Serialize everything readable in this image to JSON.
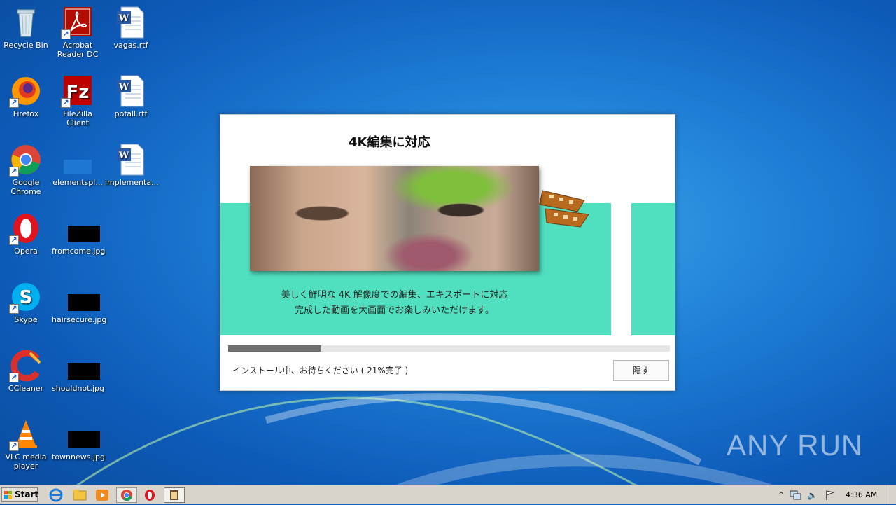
{
  "desktop": {
    "icons": [
      {
        "label": "Recycle Bin",
        "icon": "recycle-bin-icon"
      },
      {
        "label": "Acrobat Reader DC",
        "icon": "acrobat-icon"
      },
      {
        "label": "vagas.rtf",
        "icon": "word-doc-icon"
      },
      {
        "label": "Firefox",
        "icon": "firefox-icon"
      },
      {
        "label": "FileZilla Client",
        "icon": "filezilla-icon"
      },
      {
        "label": "pofall.rtf",
        "icon": "word-doc-icon"
      },
      {
        "label": "Google Chrome",
        "icon": "chrome-icon"
      },
      {
        "label": "elementspl...",
        "icon": "blank-file-icon"
      },
      {
        "label": "implementa...",
        "icon": "word-doc-icon"
      },
      {
        "label": "Opera",
        "icon": "opera-icon"
      },
      {
        "label": "fromcome.jpg",
        "icon": "image-thumb-icon"
      },
      {
        "label": "Skype",
        "icon": "skype-icon"
      },
      {
        "label": "hairsecure.jpg",
        "icon": "image-thumb-icon"
      },
      {
        "label": "CCleaner",
        "icon": "ccleaner-icon"
      },
      {
        "label": "shouldnot.jpg",
        "icon": "image-thumb-icon"
      },
      {
        "label": "VLC media player",
        "icon": "vlc-icon"
      },
      {
        "label": "townnews.jpg",
        "icon": "image-thumb-icon"
      }
    ]
  },
  "installer": {
    "slide_title": "4K編集に対応",
    "caption_line1": "美しく鮮明な 4K 解像度での編集、エキスポートに対応",
    "caption_line2": "完成した動画を大画面でお楽しみいただけます。",
    "progress_fraction": 0.21,
    "status": "インストール中、お待ちください ( 21%完了 )",
    "hide_button": "隠す"
  },
  "taskbar": {
    "start_label": "Start",
    "clock": "4:36 AM",
    "pinned": [
      "ie-icon",
      "explorer-icon",
      "media-player-icon",
      "chrome-icon",
      "opera-icon",
      "installer-app-icon"
    ]
  },
  "watermark": "ANY RUN",
  "colors": {
    "teal": "#50e0bf",
    "progress": "#6f6f6f",
    "desktop_blue": "#1f7fd6"
  }
}
